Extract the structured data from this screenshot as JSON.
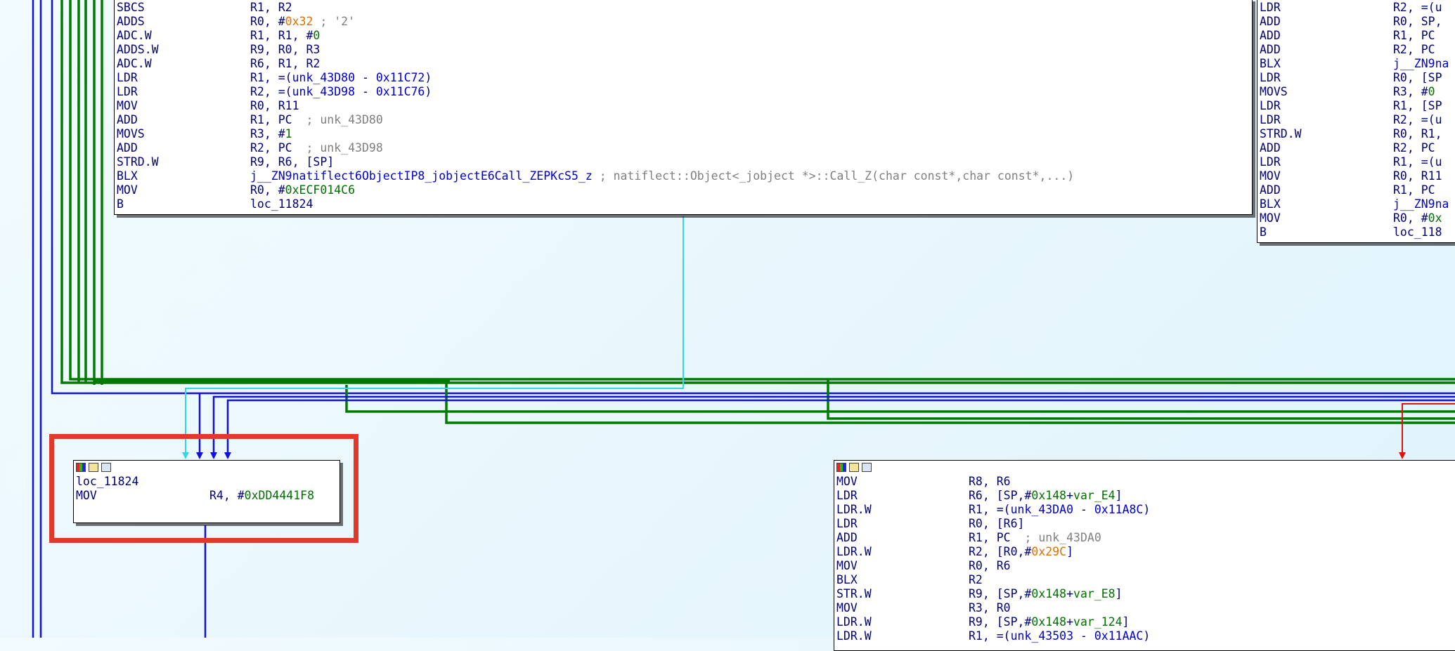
{
  "node_top_left": {
    "rows": [
      {
        "mn": "SBCS",
        "ops": [
          {
            "t": "R1, R2",
            "c": "hl"
          }
        ]
      },
      {
        "mn": "ADDS",
        "ops": [
          {
            "t": "R0, #",
            "c": "hl"
          },
          {
            "t": "0x32",
            "c": "hex"
          },
          {
            "t": " ; '2'",
            "c": "cmt"
          }
        ]
      },
      {
        "mn": "ADC.W",
        "ops": [
          {
            "t": "R1, R1, #",
            "c": "hl"
          },
          {
            "t": "0",
            "c": "num"
          }
        ]
      },
      {
        "mn": "ADDS.W",
        "ops": [
          {
            "t": "R9, R0, R3",
            "c": "hl"
          }
        ]
      },
      {
        "mn": "ADC.W",
        "ops": [
          {
            "t": "R6, R1, R2",
            "c": "hl"
          }
        ]
      },
      {
        "mn": "LDR",
        "ops": [
          {
            "t": "R1, =(",
            "c": "hl"
          },
          {
            "t": "unk_43D80",
            "c": "sym"
          },
          {
            "t": " - ",
            "c": "hl"
          },
          {
            "t": "0x11C72",
            "c": "sym"
          },
          {
            "t": ")",
            "c": "hl"
          }
        ]
      },
      {
        "mn": "LDR",
        "ops": [
          {
            "t": "R2, =(",
            "c": "hl"
          },
          {
            "t": "unk_43D98",
            "c": "sym"
          },
          {
            "t": " - ",
            "c": "hl"
          },
          {
            "t": "0x11C76",
            "c": "sym"
          },
          {
            "t": ")",
            "c": "hl"
          }
        ]
      },
      {
        "mn": "MOV",
        "ops": [
          {
            "t": "R0, R11",
            "c": "hl"
          }
        ]
      },
      {
        "mn": "ADD",
        "ops": [
          {
            "t": "R1, PC",
            "c": "hl"
          },
          {
            "t": "  ; unk_43D80",
            "c": "cmt"
          }
        ]
      },
      {
        "mn": "MOVS",
        "ops": [
          {
            "t": "R3, #",
            "c": "hl"
          },
          {
            "t": "1",
            "c": "num"
          }
        ]
      },
      {
        "mn": "ADD",
        "ops": [
          {
            "t": "R2, PC",
            "c": "hl"
          },
          {
            "t": "  ; unk_43D98",
            "c": "cmt"
          }
        ]
      },
      {
        "mn": "STRD.W",
        "ops": [
          {
            "t": "R9, R6, [SP]",
            "c": "hl"
          }
        ]
      },
      {
        "mn": "BLX",
        "ops": [
          {
            "t": "j__ZN9natiflect6ObjectIP8_jobjectE6Call_ZEPKcS5_z",
            "c": "sym"
          },
          {
            "t": " ; natiflect::Object<_jobject *>::Call_Z(char const*,char const*,...)",
            "c": "cmt"
          }
        ]
      },
      {
        "mn": "MOV",
        "ops": [
          {
            "t": "R0, #",
            "c": "hl"
          },
          {
            "t": "0xECF014C6",
            "c": "num"
          }
        ]
      },
      {
        "mn": "B",
        "ops": [
          {
            "t": "loc_11824",
            "c": "hl"
          }
        ]
      }
    ]
  },
  "node_top_right": {
    "rows": [
      {
        "mn": "LDR",
        "ops": [
          {
            "t": "R2, =(u",
            "c": "hl"
          }
        ]
      },
      {
        "mn": "ADD",
        "ops": [
          {
            "t": "R0, SP,",
            "c": "hl"
          }
        ]
      },
      {
        "mn": "ADD",
        "ops": [
          {
            "t": "R1, PC",
            "c": "hl"
          }
        ]
      },
      {
        "mn": "ADD",
        "ops": [
          {
            "t": "R2, PC",
            "c": "hl"
          }
        ]
      },
      {
        "mn": "BLX",
        "ops": [
          {
            "t": "j__ZN9na",
            "c": "sym"
          }
        ]
      },
      {
        "mn": "LDR",
        "ops": [
          {
            "t": "R0, [SP",
            "c": "hl"
          }
        ]
      },
      {
        "mn": "MOVS",
        "ops": [
          {
            "t": "R3, #",
            "c": "hl"
          },
          {
            "t": "0",
            "c": "num"
          }
        ]
      },
      {
        "mn": "LDR",
        "ops": [
          {
            "t": "R1, [SP",
            "c": "hl"
          }
        ]
      },
      {
        "mn": "LDR",
        "ops": [
          {
            "t": "R2, =(u",
            "c": "hl"
          }
        ]
      },
      {
        "mn": "STRD.W",
        "ops": [
          {
            "t": "R0, R1,",
            "c": "hl"
          }
        ]
      },
      {
        "mn": "ADD",
        "ops": [
          {
            "t": "R2, PC",
            "c": "hl"
          }
        ]
      },
      {
        "mn": "LDR",
        "ops": [
          {
            "t": "R1, =(u",
            "c": "hl"
          }
        ]
      },
      {
        "mn": "MOV",
        "ops": [
          {
            "t": "R0, R11",
            "c": "hl"
          }
        ]
      },
      {
        "mn": "ADD",
        "ops": [
          {
            "t": "R1, PC",
            "c": "hl"
          }
        ]
      },
      {
        "mn": "BLX",
        "ops": [
          {
            "t": "j__ZN9na",
            "c": "sym"
          }
        ]
      },
      {
        "mn": "MOV",
        "ops": [
          {
            "t": "R0, #",
            "c": "hl"
          },
          {
            "t": "0x",
            "c": "num"
          }
        ]
      },
      {
        "mn": "B",
        "ops": [
          {
            "t": "loc_118",
            "c": "hl"
          }
        ]
      }
    ]
  },
  "node_loc": {
    "rows": [
      {
        "mn": "",
        "ops": []
      },
      {
        "mn": "loc_11824",
        "ops": []
      },
      {
        "mn": "MOV",
        "ops": [
          {
            "t": "R4, #",
            "c": "hl"
          },
          {
            "t": "0xDD4441F8",
            "c": "num"
          }
        ]
      }
    ]
  },
  "node_bottom_right": {
    "rows": [
      {
        "mn": "MOV",
        "ops": [
          {
            "t": "R8, R6",
            "c": "hl"
          }
        ]
      },
      {
        "mn": "LDR",
        "ops": [
          {
            "t": "R6, [SP,#",
            "c": "hl"
          },
          {
            "t": "0x148",
            "c": "num"
          },
          {
            "t": "+",
            "c": "hl"
          },
          {
            "t": "var_E4",
            "c": "num"
          },
          {
            "t": "]",
            "c": "hl"
          }
        ]
      },
      {
        "mn": "LDR.W",
        "ops": [
          {
            "t": "R1, =(",
            "c": "hl"
          },
          {
            "t": "unk_43DA0",
            "c": "sym"
          },
          {
            "t": " - ",
            "c": "hl"
          },
          {
            "t": "0x11A8C",
            "c": "sym"
          },
          {
            "t": ")",
            "c": "hl"
          }
        ]
      },
      {
        "mn": "LDR",
        "ops": [
          {
            "t": "R0, [R6]",
            "c": "hl"
          }
        ]
      },
      {
        "mn": "ADD",
        "ops": [
          {
            "t": "R1, PC",
            "c": "hl"
          },
          {
            "t": "  ; unk_43DA0",
            "c": "cmt"
          }
        ]
      },
      {
        "mn": "LDR.W",
        "ops": [
          {
            "t": "R2, [R0,#",
            "c": "hl"
          },
          {
            "t": "0x29C",
            "c": "hex"
          },
          {
            "t": "]",
            "c": "hl"
          }
        ]
      },
      {
        "mn": "MOV",
        "ops": [
          {
            "t": "R0, R6",
            "c": "hl"
          }
        ]
      },
      {
        "mn": "BLX",
        "ops": [
          {
            "t": "R2",
            "c": "hl"
          }
        ]
      },
      {
        "mn": "STR.W",
        "ops": [
          {
            "t": "R9, [SP,#",
            "c": "hl"
          },
          {
            "t": "0x148",
            "c": "num"
          },
          {
            "t": "+",
            "c": "hl"
          },
          {
            "t": "var_E8",
            "c": "num"
          },
          {
            "t": "]",
            "c": "hl"
          }
        ]
      },
      {
        "mn": "MOV",
        "ops": [
          {
            "t": "R3, R0",
            "c": "hl"
          }
        ]
      },
      {
        "mn": "LDR.W",
        "ops": [
          {
            "t": "R9, [SP,#",
            "c": "hl"
          },
          {
            "t": "0x148",
            "c": "num"
          },
          {
            "t": "+",
            "c": "hl"
          },
          {
            "t": "var_124",
            "c": "num"
          },
          {
            "t": "]",
            "c": "hl"
          }
        ]
      },
      {
        "mn": "LDR.W",
        "ops": [
          {
            "t": "R1, =(",
            "c": "hl"
          },
          {
            "t": "unk_43503",
            "c": "sym"
          },
          {
            "t": " - ",
            "c": "hl"
          },
          {
            "t": "0x11AAC",
            "c": "sym"
          },
          {
            "t": ")",
            "c": "hl"
          }
        ]
      }
    ]
  },
  "colors": {
    "green_edge": "#007a00",
    "blue_edge": "#1010e0",
    "cyan_edge": "#30d8e8",
    "red_edge": "#e01010",
    "highlight": "#e23a2a"
  }
}
